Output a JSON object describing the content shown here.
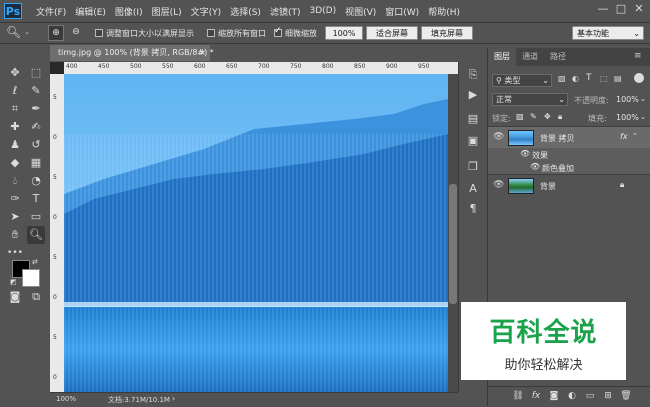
{
  "app": {
    "logo": "Ps"
  },
  "menu": [
    "文件(F)",
    "编辑(E)",
    "图像(I)",
    "图层(L)",
    "文字(Y)",
    "选择(S)",
    "滤镜(T)",
    "3D(D)",
    "视图(V)",
    "窗口(W)",
    "帮助(H)"
  ],
  "window_controls": {
    "minimize": "—",
    "maximize": "□",
    "close": "✕"
  },
  "options": {
    "resize_windows_label": "调整窗口大小以满屏显示",
    "zoom_all_label": "缩放所有窗口",
    "scrubby_zoom_label": "细微缩放",
    "zoom_value": "100%",
    "fit_screen": "适合屏幕",
    "fill_screen": "填充屏幕",
    "workspace": "基本功能"
  },
  "document": {
    "tab_title": "timg.jpg @ 100% (背景 拷贝, RGB/8#) *",
    "close": "×",
    "ruler_ticks": [
      "400",
      "450",
      "500",
      "550",
      "600",
      "650",
      "700",
      "750",
      "800",
      "850",
      "900",
      "950"
    ],
    "ruler_left_ticks": [
      "5",
      "0",
      "5",
      "0",
      "5",
      "0",
      "5",
      "0"
    ],
    "zoom": "100%",
    "doc_info": "文档:3.71M/10.1M"
  },
  "layers_panel": {
    "tabs": [
      "图层",
      "通道",
      "路径"
    ],
    "filter_kind": "类型",
    "blend_mode": "正常",
    "opacity_label": "不透明度:",
    "opacity_value": "100%",
    "lock_label": "锁定:",
    "fill_label": "填充:",
    "fill_value": "100%",
    "layers": [
      {
        "name": "背景 拷贝",
        "fx": "fx"
      },
      {
        "name": "背景"
      }
    ],
    "effects_label": "效果",
    "effect_name": "颜色叠加"
  },
  "watermark": {
    "title": "百科全说",
    "subtitle": "助你轻松解决"
  }
}
